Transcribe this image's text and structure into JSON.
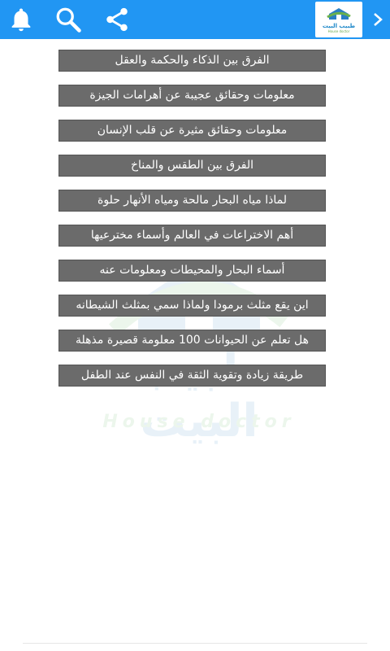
{
  "topbar": {
    "color": "#2196f3",
    "icons": [
      "bell-icon",
      "search-icon",
      "share-icon",
      "chevron-right-icon"
    ],
    "logo": {
      "text": "طبيب البيت",
      "sub": "House doctor"
    }
  },
  "watermark": {
    "arabic": "طبيب البيت",
    "english": "House doctor"
  },
  "articles": [
    "الفرق بين الذكاء والحكمة والعقل",
    "معلومات وحقائق عجيبة عن أهرامات الجيزة",
    "معلومات وحقائق مثيرة عن قلب الإنسان",
    "الفرق بين الطقس والمناخ",
    "لماذا مياه البحار مالحة ومياه الأنهار حلوة",
    "أهم الاختراعات في العالم وأسماء مخترعيها",
    "أسماء البحار والمحيطات ومعلومات عنه",
    "اين يقع مثلث برمودا ولماذا سمي بمثلث الشيطانه",
    "هل تعلم عن الحيوانات 100 معلومة قصيرة مذهلة",
    "طريقة زيادة وتقوية الثقة في النفس عند الطفل"
  ]
}
